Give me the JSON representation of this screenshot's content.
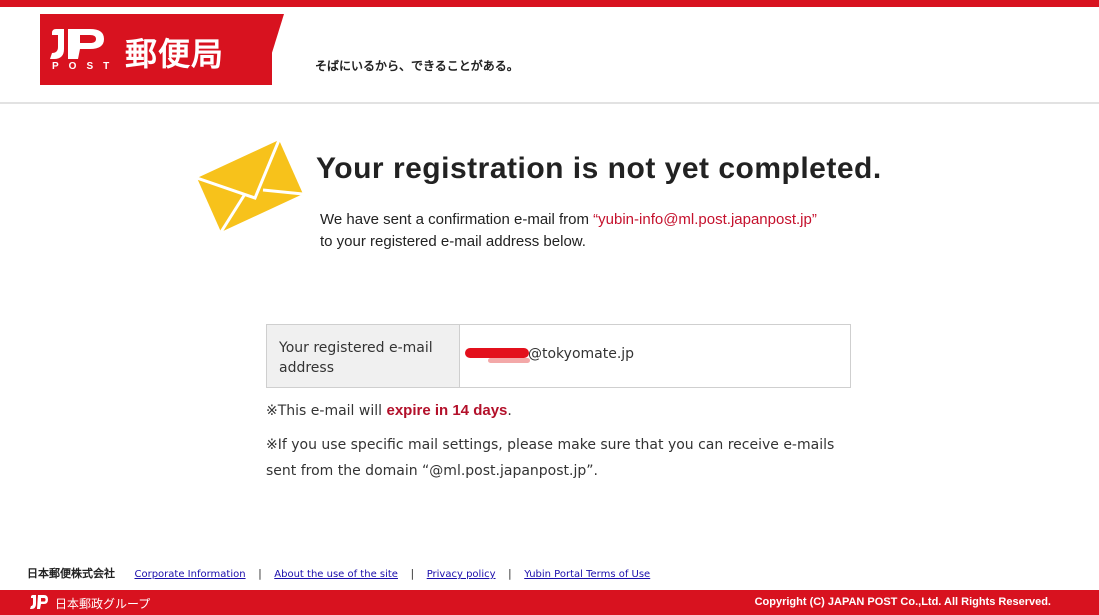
{
  "header": {
    "logo_post": "POST",
    "logo_kanji": "郵便局",
    "tagline": "そばにいるから、できることがある。",
    "brand_color": "#d8121f"
  },
  "main": {
    "title": "Your registration is not yet completed.",
    "message_before": "We have sent a confirmation e-mail from ",
    "sender_address": "“yubin-info@ml.post.japanpost.jp”",
    "message_after": " to your registered e-mail address below.",
    "accent_color": "#c5112d",
    "envelope_icon": "envelope-icon"
  },
  "registration": {
    "label": "Your registered e-mail address",
    "email_domain": "@tokyomate.jp"
  },
  "notes": {
    "expiry_prefix": "※This e-mail will ",
    "expiry_strong": "expire in 14 days",
    "expiry_suffix": ".",
    "settings_note": "※If you use specific mail settings, please make sure that you can receive e-mails sent from the domain “@ml.post.japanpost.jp”."
  },
  "footer": {
    "company": "日本郵便株式会社",
    "links": [
      "Corporate Information",
      "About the use of the site",
      "Privacy policy",
      "Yubin Portal Terms of Use"
    ],
    "separator": "|",
    "group_name": "日本郵政グループ",
    "copyright": "Copyright (C) JAPAN POST Co.,Ltd.  All Rights Reserved."
  }
}
